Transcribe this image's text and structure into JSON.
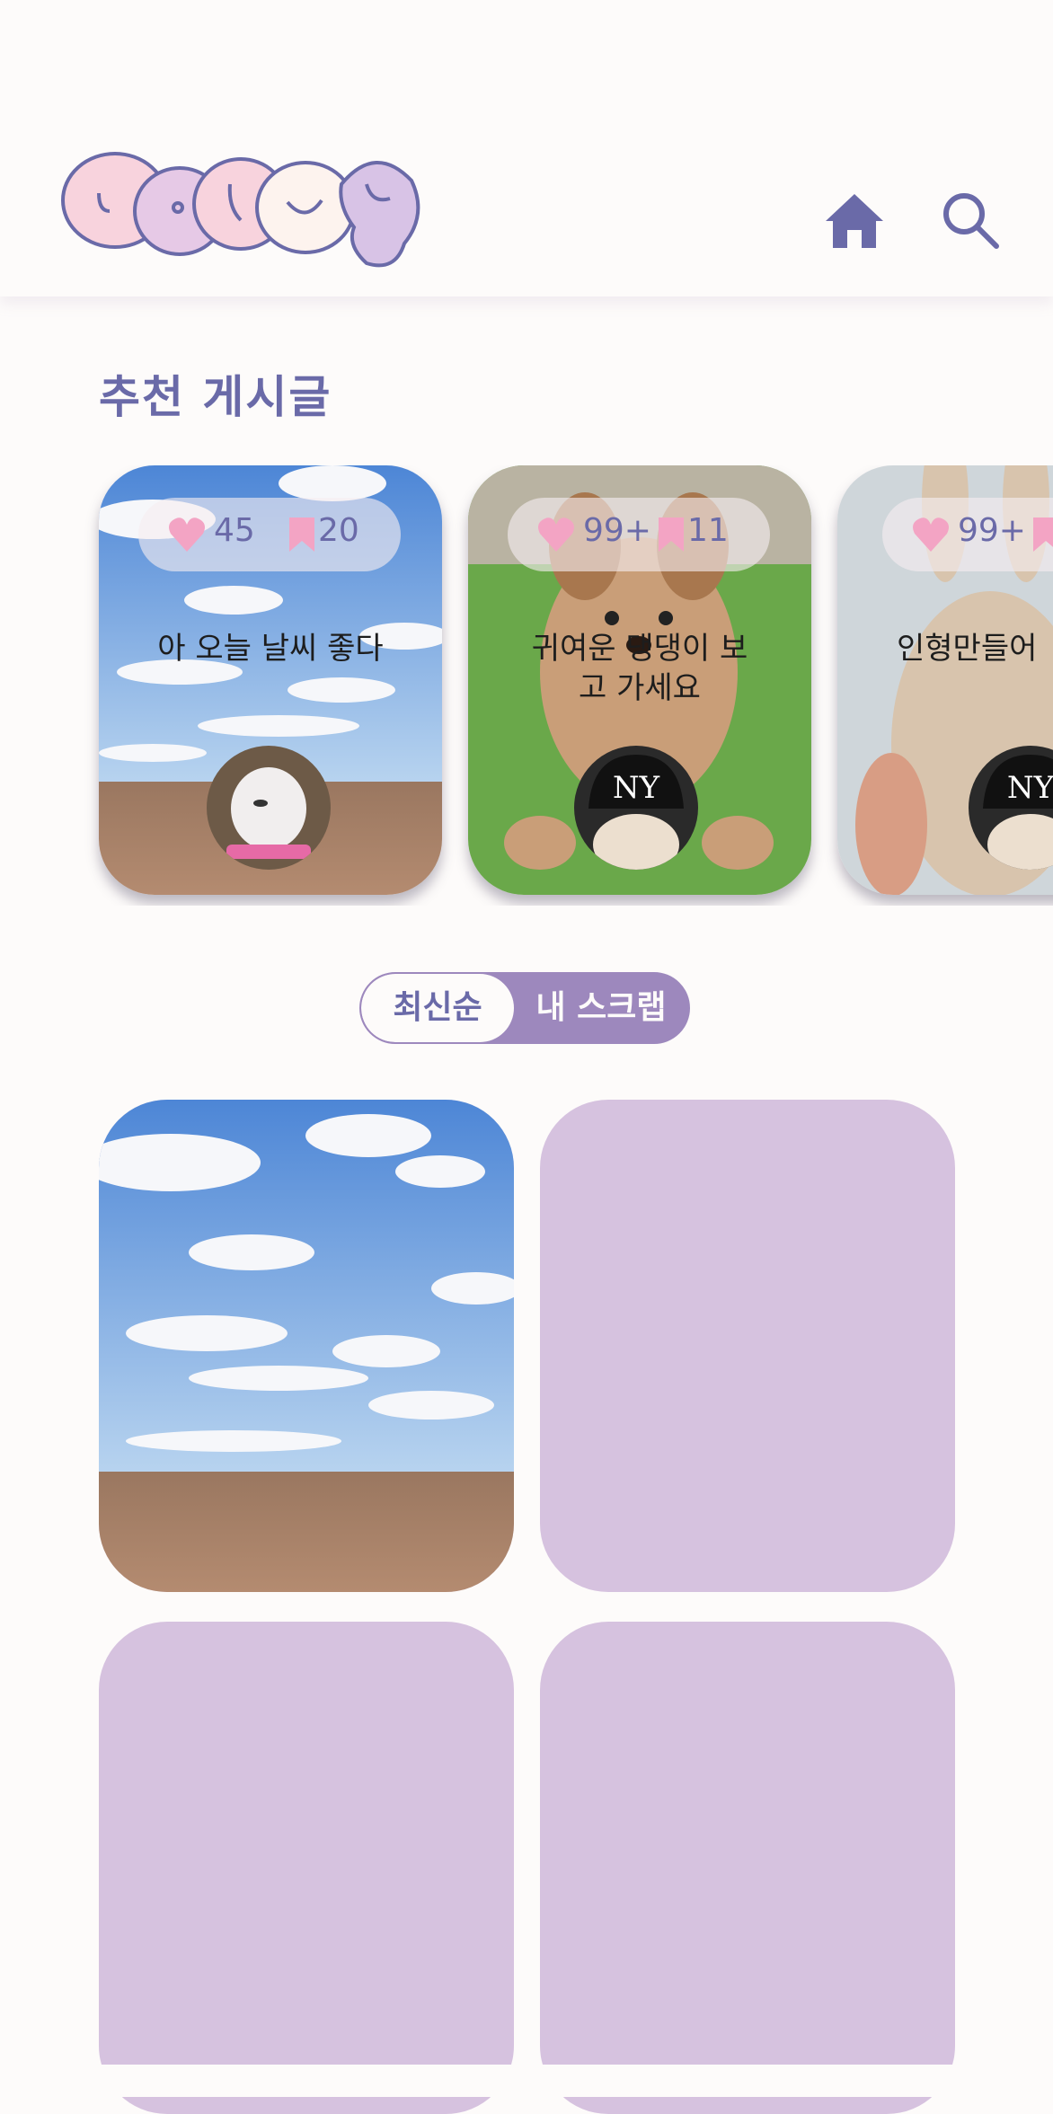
{
  "header": {
    "logo_label": "logo",
    "home_icon": "home-icon",
    "search_icon": "search-icon"
  },
  "recommended": {
    "title": "추천 게시글",
    "cards": [
      {
        "likes": "45",
        "bookmarks": "20",
        "text": "아 오늘 날씨 좋다"
      },
      {
        "likes": "99+",
        "bookmarks": "11",
        "text": "귀여운 댕댕이 보고 가세요"
      },
      {
        "likes": "99+",
        "bookmarks": "",
        "text": "인형만들어"
      }
    ]
  },
  "sort_toggle": {
    "option_latest": "최신순",
    "option_scrap": "내 스크랩",
    "selected": "최신순"
  },
  "colors": {
    "accent": "#6a6aa8",
    "lavender": "#d6c2df",
    "toggle_active": "#9d88bd",
    "heart_pink": "#f3a4c4",
    "background": "#fdfbfa"
  }
}
